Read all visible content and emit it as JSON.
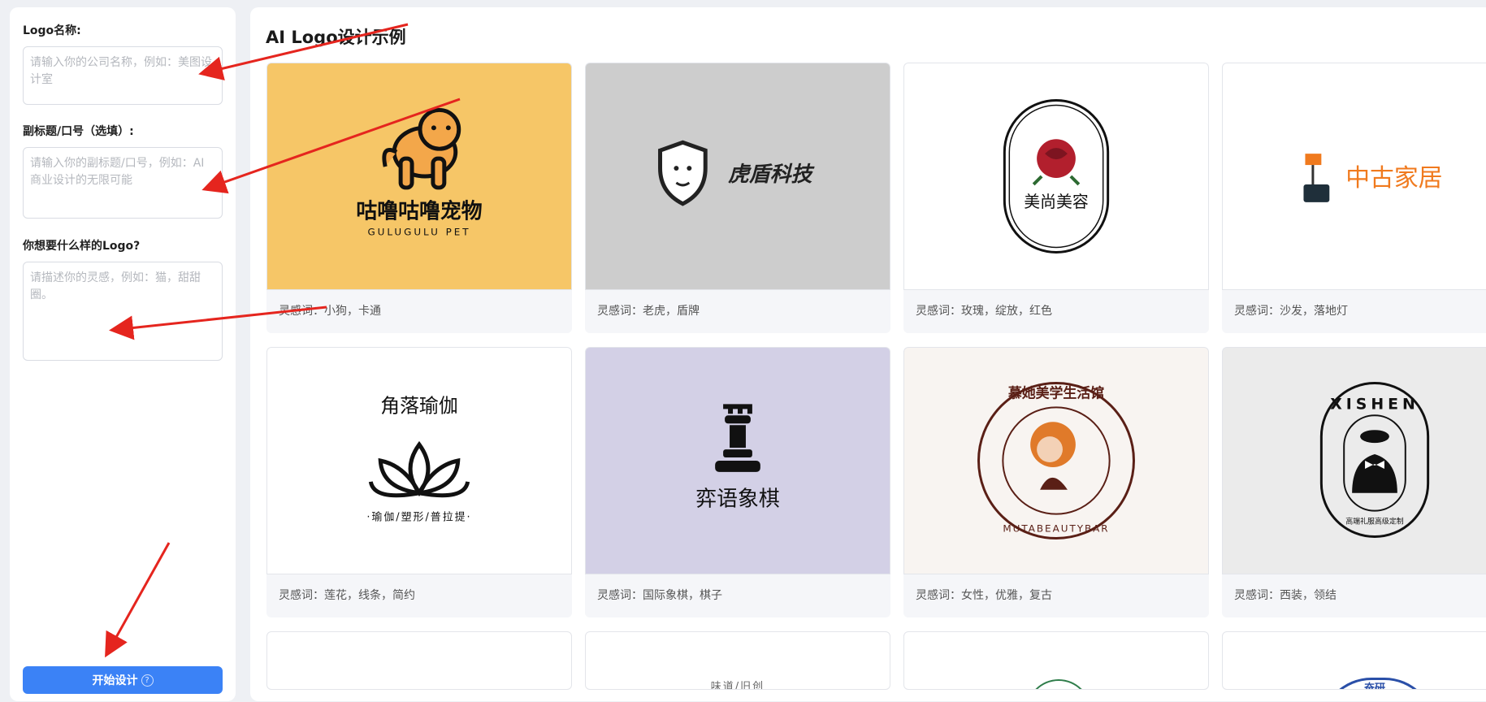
{
  "form": {
    "name_label": "Logo名称:",
    "name_placeholder": "请输入你的公司名称，例如：美图设计室",
    "subtitle_label": "副标题/口号（选填）:",
    "subtitle_placeholder": "请输入你的副标题/口号，例如：AI商业设计的无限可能",
    "desc_label": "你想要什么样的Logo?",
    "desc_placeholder": "请描述你的灵感，例如：猫，甜甜圈。",
    "start_button": "开始设计",
    "help_icon": "?"
  },
  "gallery": {
    "title": "AI Logo设计示例",
    "cards": [
      {
        "caption": "灵感词：小狗，卡通",
        "logo_text": "咕噜咕噜宠物",
        "logo_sub": "GULUGULU PET",
        "bg": "#f6c667",
        "icon": "dog-icon"
      },
      {
        "caption": "灵感词：老虎，盾牌",
        "logo_text": "虎盾科技",
        "bg": "#cdcdcd",
        "icon": "tiger-shield-icon"
      },
      {
        "caption": "灵感词：玫瑰，绽放，红色",
        "logo_text": "美尚美容",
        "bg": "#ffffff",
        "icon": "rose-icon"
      },
      {
        "caption": "灵感词：沙发，落地灯",
        "logo_text": "中古家居",
        "bg": "#ffffff",
        "icon": "sofa-lamp-icon"
      },
      {
        "caption": "灵感词：莲花，线条，简约",
        "logo_text": "角落瑜伽",
        "logo_sub": "·瑜伽/塑形/普拉提·",
        "bg": "#ffffff",
        "icon": "lotus-icon"
      },
      {
        "caption": "灵感词：国际象棋，棋子",
        "logo_text": "弈语象棋",
        "bg": "#d3d0e6",
        "icon": "chess-rook-icon"
      },
      {
        "caption": "灵感词：女性，优雅，复古",
        "logo_text": "慕她美学生活馆",
        "logo_sub": "MUTABEAUTYBAR",
        "bg": "#f8f4f1",
        "icon": "woman-portrait-icon"
      },
      {
        "caption": "灵感词：西装，领结",
        "logo_text": "XISHEN",
        "logo_sub": "高端礼服高级定制",
        "bg": "#ebebeb",
        "icon": "tuxedo-icon"
      }
    ],
    "partial_row": [
      "",
      "味道/旧创",
      "",
      "奋研"
    ]
  },
  "colors": {
    "accent": "#3b82f6",
    "arrow": "#e5251e"
  }
}
